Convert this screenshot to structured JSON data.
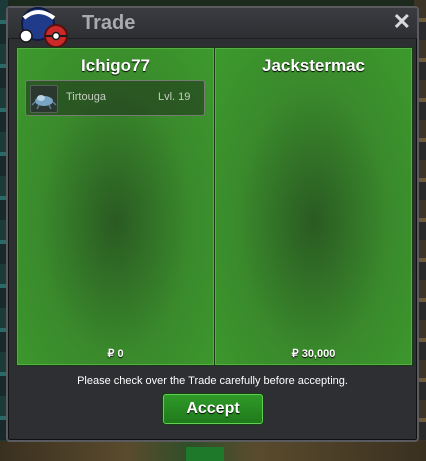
{
  "window": {
    "title": "Trade"
  },
  "icons": {
    "logo": "trade-logo-icon",
    "close": "close-icon"
  },
  "close_glyph": "✕",
  "left_panel": {
    "name": "Ichigo77",
    "items": [
      {
        "name": "Tirtouga",
        "level": "Lvl. 19"
      }
    ],
    "money": "₽ 0"
  },
  "right_panel": {
    "name": "Jackstermac",
    "items": [],
    "money": "₽ 30,000"
  },
  "notice": "Please check over the Trade carefully before accepting.",
  "accept_label": "Accept",
  "colors": {
    "panel_green": "#3c9a2d",
    "button_green": "#2f9a28",
    "window_bg": "#2e2f33"
  }
}
